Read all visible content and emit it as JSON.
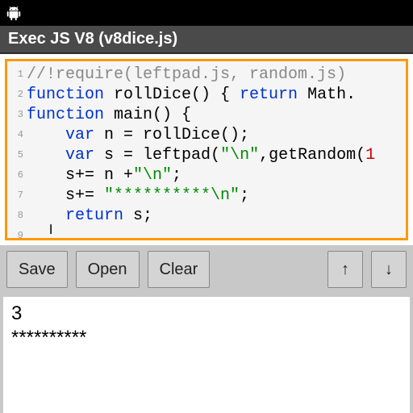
{
  "title": "Exec JS V8 (v8dice.js)",
  "code": {
    "lines": [
      1,
      2,
      3,
      4,
      5,
      6,
      7,
      8,
      9
    ],
    "l1_comment": "//!require(leftpad.js, random.js)",
    "l2_kw1": "function",
    "l2_name": " rollDice() { ",
    "l2_kw2": "return",
    "l2_tail": " Math.",
    "l3_kw": "function",
    "l3_rest": " main() {",
    "l4_indent": "    ",
    "l4_kw": "var",
    "l4_rest": " n = rollDice();",
    "l5_indent": "    ",
    "l5_kw": "var",
    "l5_mid": " s = leftpad(",
    "l5_str": "\"\\n\"",
    "l5_mid2": ",getRandom(",
    "l5_num": "1",
    "l6_indent": "    ",
    "l6_a": "s+= n +",
    "l6_str": "\"\\n\"",
    "l6_b": ";",
    "l7_indent": "    ",
    "l7_a": "s+= ",
    "l7_str": "\"**********\\n\"",
    "l7_b": ";",
    "l8_indent": "    ",
    "l8_kw": "return",
    "l8_rest": " s;",
    "l9": "  ╵"
  },
  "toolbar": {
    "save": "Save",
    "open": "Open",
    "clear": "Clear",
    "up": "↑",
    "down": "↓"
  },
  "output": "3\n**********"
}
